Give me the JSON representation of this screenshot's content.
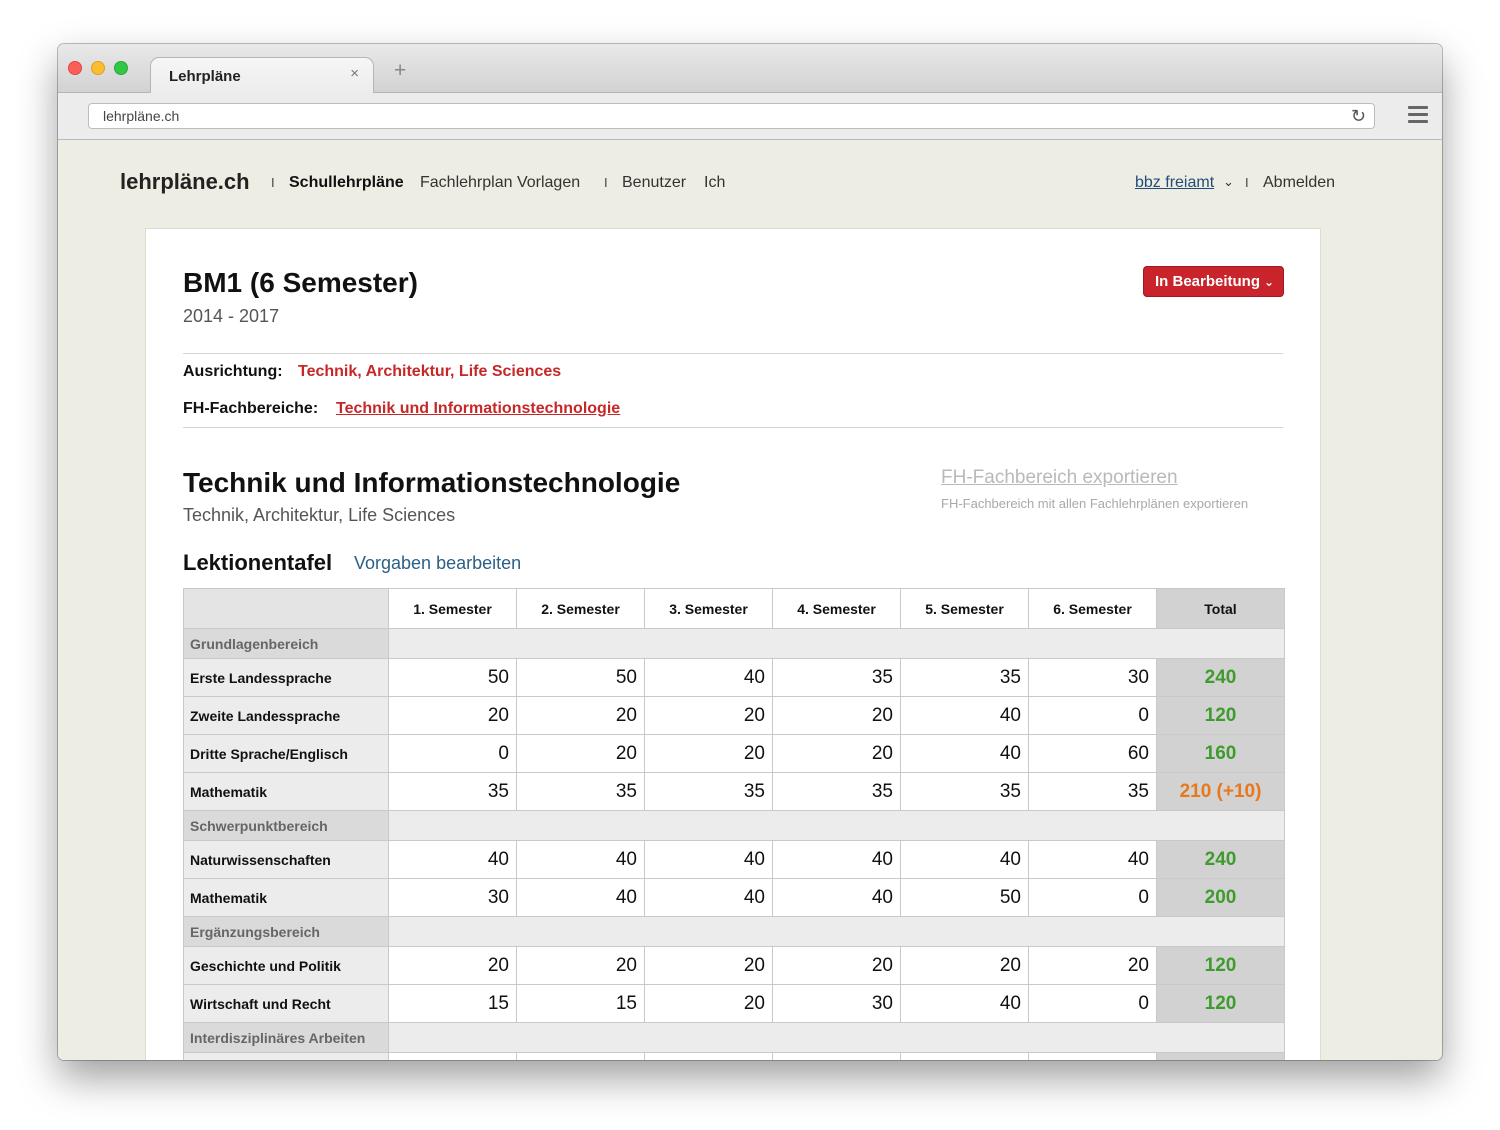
{
  "browser": {
    "tab_title": "Lehrpläne",
    "tab_close": "×",
    "new_tab": "+",
    "url": "lehrpläne.ch"
  },
  "nav": {
    "brand": "lehrpläne.ch",
    "separator": "I",
    "items": [
      {
        "label": "Schullehrpläne",
        "active": true
      },
      {
        "label": "Fachlehrplan Vorlagen",
        "active": false
      },
      {
        "label": "Benutzer",
        "active": false
      },
      {
        "label": "Ich",
        "active": false
      }
    ],
    "org": "bbz freiamt",
    "logout": "Abmelden"
  },
  "page": {
    "title": "BM1 (6 Semester)",
    "years": "2014 - 2017",
    "status": "In Bearbeitung",
    "ausrichtung_label": "Ausrichtung:",
    "ausrichtung_value": "Technik, Architektur, Life Sciences",
    "fachbereiche_label": "FH-Fachbereiche:",
    "fachbereiche_value": "Technik und Informationstechnologie"
  },
  "section": {
    "title": "Technik und Informationstechnologie",
    "subtitle": "Technik, Architektur, Life Sciences",
    "export_link": "FH-Fachbereich exportieren",
    "export_hint": "FH-Fachbereich mit allen Fachlehrplänen exportieren"
  },
  "lektionentafel": {
    "title": "Lektionentafel",
    "edit_link": "Vorgaben bearbeiten",
    "columns": [
      "1. Semester",
      "2. Semester",
      "3. Semester",
      "4. Semester",
      "5. Semester",
      "6. Semester",
      "Total"
    ],
    "groups": [
      {
        "name": "Grundlagenbereich",
        "rows": [
          {
            "subject": "Erste Landessprache",
            "values": [
              "50",
              "50",
              "40",
              "35",
              "35",
              "30"
            ],
            "total": "240",
            "total_status": "ok"
          },
          {
            "subject": "Zweite Landessprache",
            "values": [
              "20",
              "20",
              "20",
              "20",
              "40",
              "0"
            ],
            "total": "120",
            "total_status": "ok"
          },
          {
            "subject": "Dritte Sprache/Englisch",
            "values": [
              "0",
              "20",
              "20",
              "20",
              "40",
              "60"
            ],
            "total": "160",
            "total_status": "ok"
          },
          {
            "subject": "Mathematik",
            "values": [
              "35",
              "35",
              "35",
              "35",
              "35",
              "35"
            ],
            "total": "210 (+10)",
            "total_status": "warn"
          }
        ]
      },
      {
        "name": "Schwerpunktbereich",
        "rows": [
          {
            "subject": "Naturwissenschaften",
            "values": [
              "40",
              "40",
              "40",
              "40",
              "40",
              "40"
            ],
            "total": "240",
            "total_status": "ok"
          },
          {
            "subject": "Mathematik",
            "values": [
              "30",
              "40",
              "40",
              "40",
              "50",
              "0"
            ],
            "total": "200",
            "total_status": "ok"
          }
        ]
      },
      {
        "name": "Ergänzungsbereich",
        "rows": [
          {
            "subject": "Geschichte und Politik",
            "values": [
              "20",
              "20",
              "20",
              "20",
              "20",
              "20"
            ],
            "total": "120",
            "total_status": "ok"
          },
          {
            "subject": "Wirtschaft und Recht",
            "values": [
              "15",
              "15",
              "20",
              "30",
              "40",
              "0"
            ],
            "total": "120",
            "total_status": "ok"
          }
        ]
      },
      {
        "name": "Interdisziplinäres Arbeiten",
        "rows": [
          {
            "subject": "",
            "values": [
              "",
              "",
              "",
              "",
              "",
              ""
            ],
            "total": "",
            "total_status": "ok"
          }
        ]
      }
    ]
  },
  "colors": {
    "accent_red": "#c9242b",
    "total_ok": "#3f9b2c",
    "total_warn": "#e8781d",
    "link_blue": "#2a5f86",
    "page_bg": "#eeede3"
  }
}
